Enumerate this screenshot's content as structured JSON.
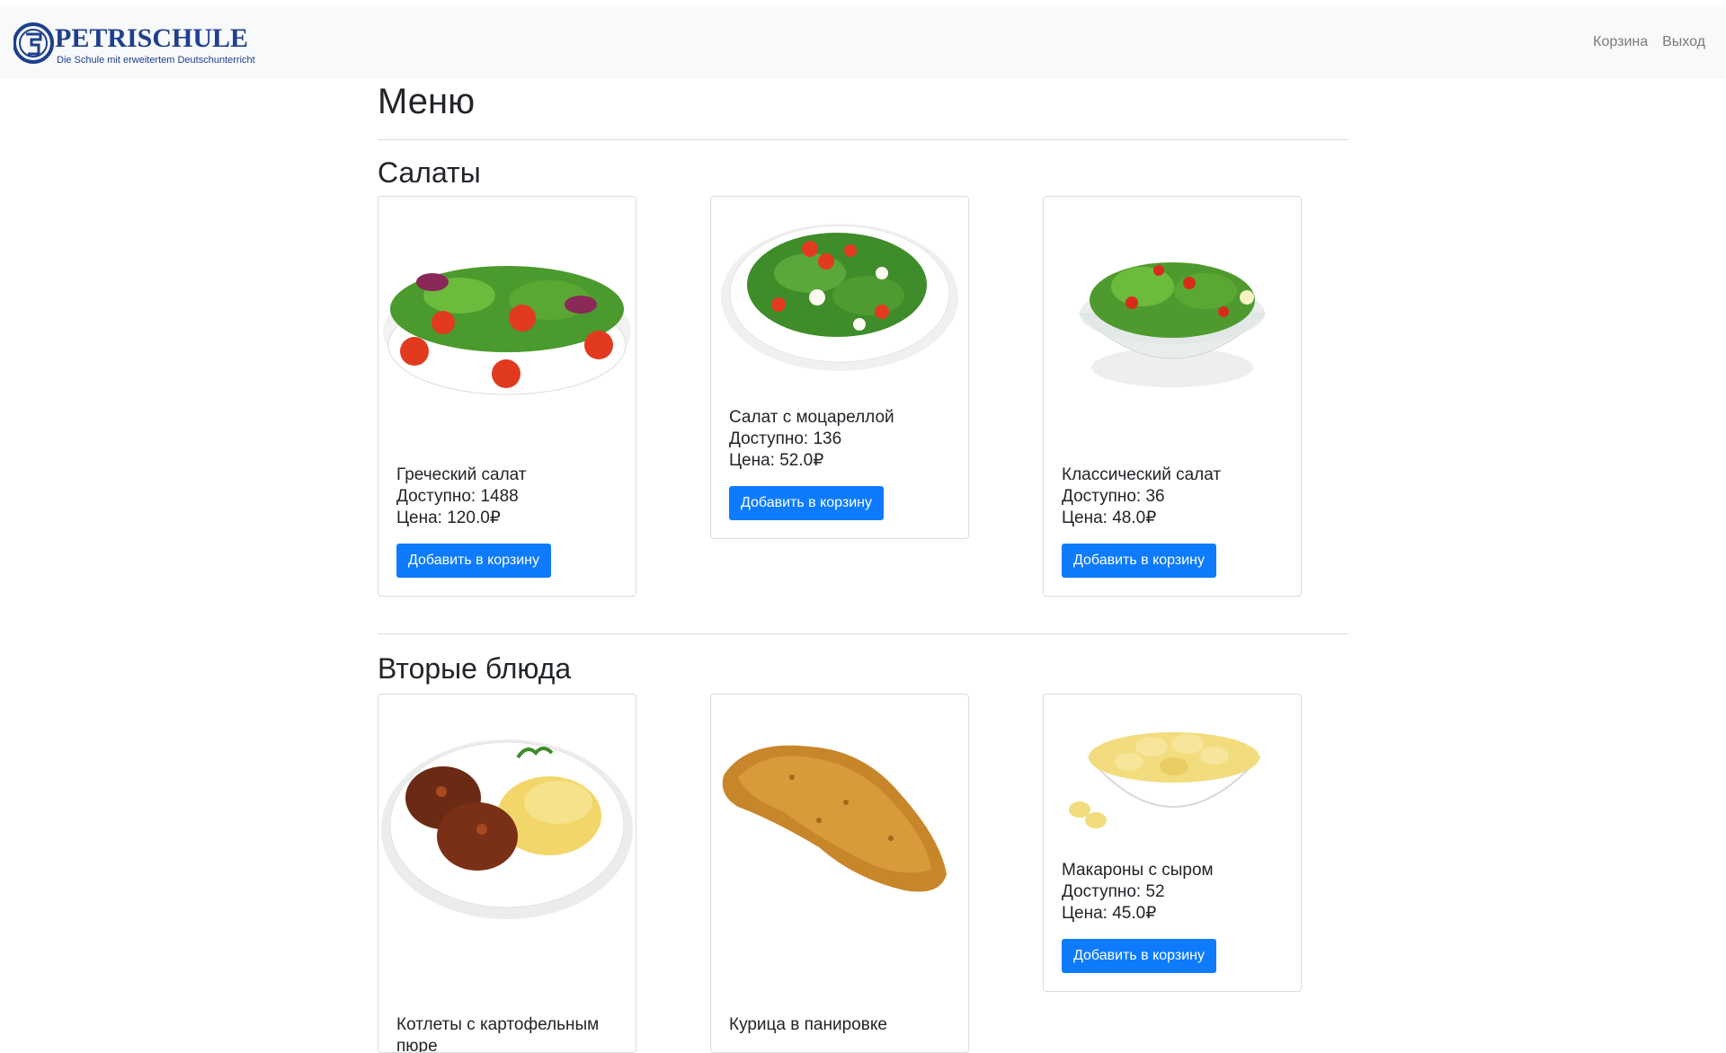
{
  "brand": {
    "logo_text": "PETRISCHULE",
    "tagline": "Die Schule mit erweitertem Deutschunterricht"
  },
  "nav": {
    "cart": "Корзина",
    "logout": "Выход"
  },
  "page": {
    "title": "Меню"
  },
  "labels": {
    "available": "Доступно: ",
    "price": "Цена: ",
    "currency": "₽",
    "add_to_cart": "Добавить в корзину"
  },
  "sections": [
    {
      "title": "Салаты",
      "items": [
        {
          "name": "Греческий салат",
          "available_text": "Доступно: 1488",
          "price_text": "Цена: 120.0₽",
          "button": "Добавить в корзину",
          "image": "salad-bowl"
        },
        {
          "name": "Салат с моцареллой",
          "available_text": "Доступно: 136",
          "price_text": "Цена: 52.0₽",
          "button": "Добавить в корзину",
          "image": "mozzarella-salad"
        },
        {
          "name": "Классический салат",
          "available_text": "Доступно: 36",
          "price_text": "Цена: 48.0₽",
          "button": "Добавить в корзину",
          "image": "classic-salad"
        }
      ]
    },
    {
      "title": "Вторые блюда",
      "items": [
        {
          "name": "Котлеты с картофельным пюре",
          "image": "cutlets-puree"
        },
        {
          "name": "Курица в панировке",
          "image": "breaded-schnitzel"
        },
        {
          "name": "Макароны с сыром",
          "available_text": "Доступно: 52",
          "price_text": "Цена: 45.0₽",
          "button": "Добавить в корзину",
          "image": "mac-and-cheese"
        }
      ]
    }
  ],
  "colors": {
    "navbar_bg": "#f8f9fa",
    "button_bg": "#0d7bfc",
    "brand_blue": "#1f3f8f"
  }
}
